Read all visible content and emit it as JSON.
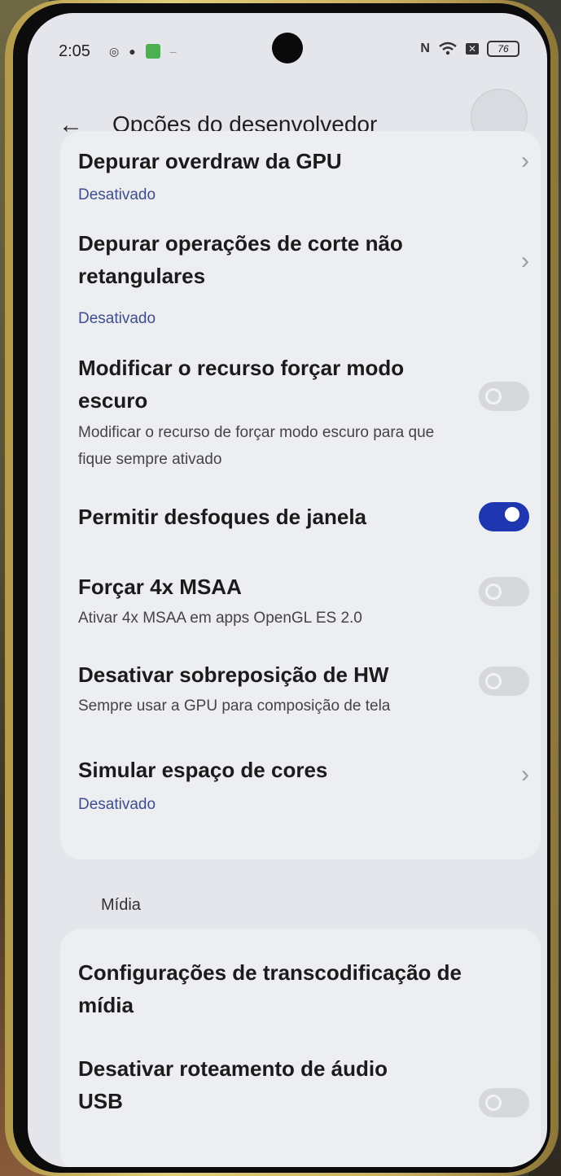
{
  "status_bar": {
    "time": "2:05",
    "battery": "76",
    "icons_left": [
      "whatsapp-icon",
      "notification-dot-icon",
      "app-badge-icon",
      "dash-icon"
    ],
    "icons_right": [
      "nfc-icon",
      "wifi-icon",
      "close-box-icon",
      "battery-icon"
    ]
  },
  "header": {
    "title": "Opções do desenvolvedor",
    "back_icon": "arrow-left-icon"
  },
  "settings": [
    {
      "title": "Depurar overdraw da GPU",
      "subtitle": "Desativado",
      "control": "chevron"
    },
    {
      "title": "Depurar operações de corte não retangulares",
      "subtitle": "Desativado",
      "control": "chevron"
    },
    {
      "title": "Modificar o recurso forçar modo escuro",
      "description": "Modificar o recurso de forçar modo escuro para que fique sempre ativado",
      "control": "toggle",
      "enabled": false
    },
    {
      "title": "Permitir desfoques de janela",
      "control": "toggle",
      "enabled": true
    },
    {
      "title": "Forçar 4x MSAA",
      "description": "Ativar 4x MSAA em apps OpenGL ES 2.0",
      "control": "toggle",
      "enabled": false
    },
    {
      "title": "Desativar sobreposição de HW",
      "description": "Sempre usar a GPU para composição de tela",
      "control": "toggle",
      "enabled": false
    },
    {
      "title": "Simular espaço de cores",
      "subtitle": "Desativado",
      "control": "chevron"
    }
  ],
  "media_section": {
    "label": "Mídia",
    "items": [
      {
        "title": "Configurações de transcodificação de mídia",
        "control": "none"
      },
      {
        "title": "Desativar roteamento de áudio USB",
        "control": "toggle",
        "enabled": false
      }
    ]
  },
  "colors": {
    "accent": "#1e36b0",
    "subtitle_blue": "#3e4d8f",
    "background": "#e4e6eb",
    "card": "#eceef2"
  }
}
